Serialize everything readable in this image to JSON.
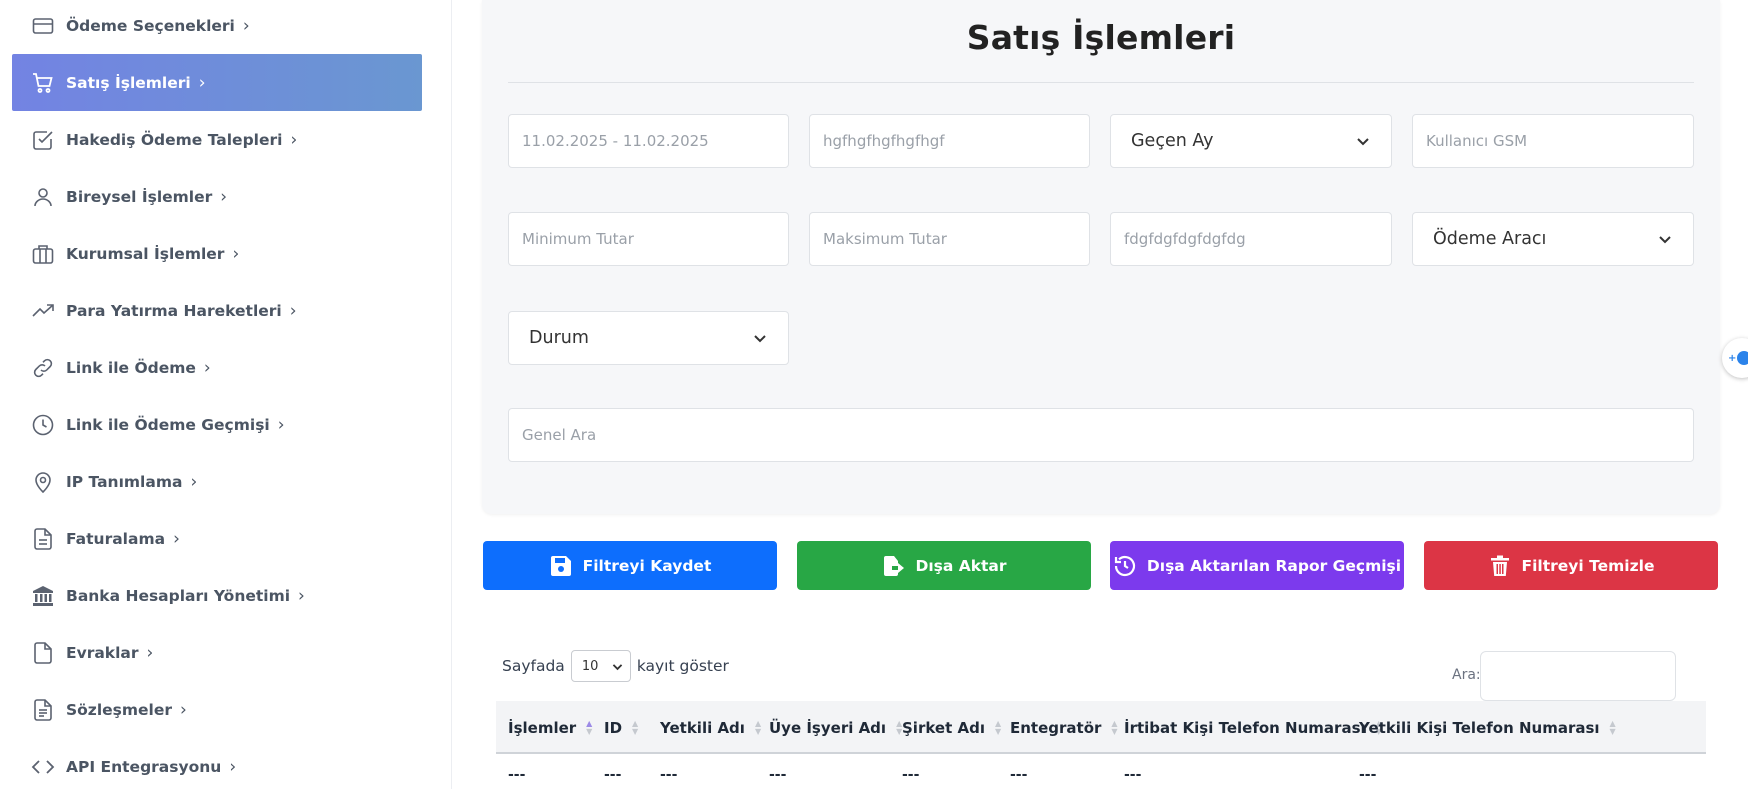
{
  "sidebar": {
    "items": [
      {
        "label": "Ödeme Seçenekleri",
        "icon": "credit-card-icon"
      },
      {
        "label": "Satış İşlemleri",
        "icon": "cart-icon",
        "active": true
      },
      {
        "label": "Hakediş Ödeme Talepleri",
        "icon": "checkbox-icon"
      },
      {
        "label": "Bireysel İşlemler",
        "icon": "user-icon"
      },
      {
        "label": "Kurumsal İşlemler",
        "icon": "briefcase-icon"
      },
      {
        "label": "Para Yatırma Hareketleri",
        "icon": "trending-up-icon"
      },
      {
        "label": "Link ile Ödeme",
        "icon": "link-icon"
      },
      {
        "label": "Link ile Ödeme Geçmişi",
        "icon": "clock-icon"
      },
      {
        "label": "IP Tanımlama",
        "icon": "location-pin-icon"
      },
      {
        "label": "Faturalama",
        "icon": "invoice-icon"
      },
      {
        "label": "Banka Hesapları Yönetimi",
        "icon": "bank-icon"
      },
      {
        "label": "Evraklar",
        "icon": "file-icon"
      },
      {
        "label": "Sözleşmeler",
        "icon": "contract-icon"
      },
      {
        "label": "API Entegrasyonu",
        "icon": "code-icon"
      }
    ]
  },
  "page": {
    "title": "Satış İşlemleri"
  },
  "filters": {
    "date_range": {
      "placeholder": "11.02.2025 - 11.02.2025"
    },
    "text1": {
      "value": "hgfhgfhgfhgfhgf"
    },
    "period_select": {
      "value": "Geçen Ay"
    },
    "user_gsm": {
      "placeholder": "Kullanıcı GSM"
    },
    "min_amount": {
      "placeholder": "Minimum Tutar"
    },
    "max_amount": {
      "placeholder": "Maksimum Tutar"
    },
    "text2": {
      "value": "fdgfdgfdgfdgfdg"
    },
    "payment_tool_select": {
      "value": "Ödeme Aracı"
    },
    "status_select": {
      "value": "Durum"
    },
    "general_search": {
      "placeholder": "Genel Ara"
    }
  },
  "actions": {
    "save_filter": "Filtreyi Kaydet",
    "export": "Dışa Aktar",
    "export_history": "Dışa Aktarılan Rapor Geçmişi",
    "clear_filter": "Filtreyi Temizle"
  },
  "colors": {
    "blue": "#0d6efd",
    "green": "#28a745",
    "purple": "#7c3aed",
    "red": "#dc3545",
    "active_gradient_start": "#7383e3",
    "active_gradient_end": "#6a97d1"
  },
  "table": {
    "per_page_prefix": "Sayfada",
    "per_page_value": "10",
    "per_page_suffix": "kayıt göster",
    "search_label": "Ara:",
    "columns": [
      "İşlemler",
      "ID",
      "Yetkili Adı",
      "Üye İşyeri Adı",
      "Şirket Adı",
      "Entegratör",
      "İrtibat Kişi Telefon Numarası",
      "Yetkili Kişi Telefon Numarası"
    ],
    "row": [
      "---",
      "---",
      "---",
      "---",
      "---",
      "---",
      "---",
      "---"
    ]
  }
}
